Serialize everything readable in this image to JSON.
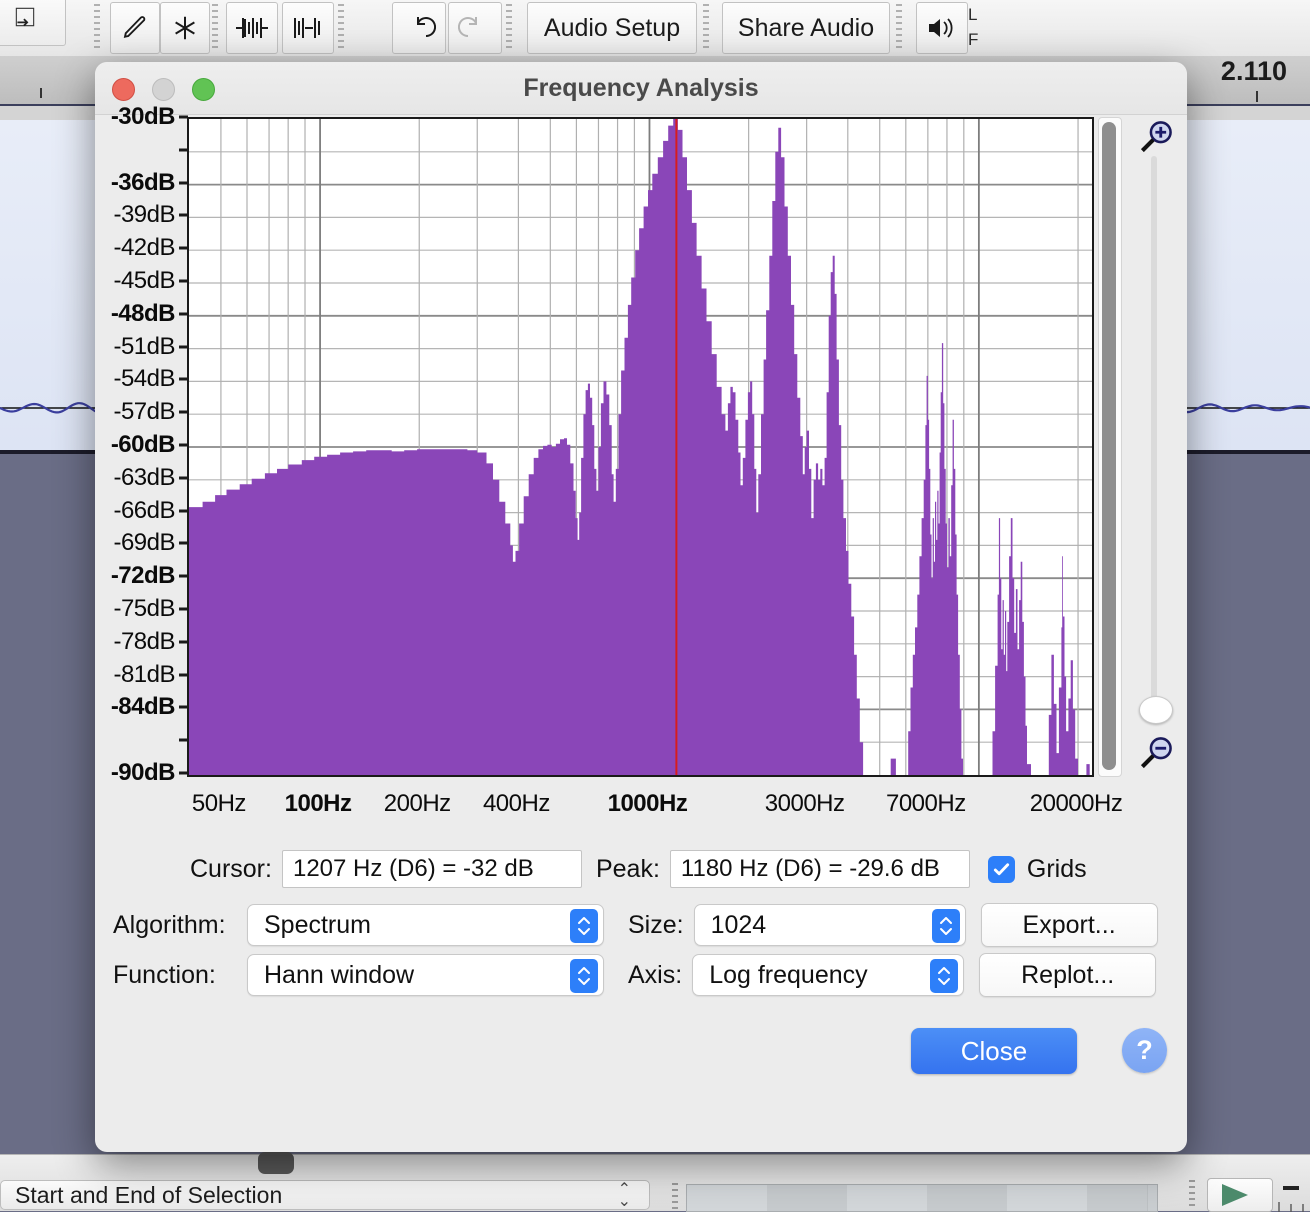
{
  "app": {
    "toolbar": {
      "buttons": [
        {
          "name": "draw-tool",
          "icon": "pencil-icon",
          "label": ""
        },
        {
          "name": "multi-tool",
          "icon": "asterisk-icon",
          "label": ""
        },
        {
          "name": "zoom-in-selection",
          "icon": "trim-audio-icon",
          "label": ""
        },
        {
          "name": "silence-selection",
          "icon": "silence-audio-icon",
          "label": ""
        },
        {
          "name": "undo",
          "icon": "undo-arrow-icon",
          "label": ""
        },
        {
          "name": "redo",
          "icon": "redo-arrow-icon",
          "label": ""
        }
      ],
      "audio_setup_label": "Audio Setup",
      "share_audio_label": "Share Audio",
      "speaker_icon": "speaker-icon",
      "channel_labels": [
        "L",
        "F"
      ]
    },
    "timeline": {
      "time_label": "2.110"
    },
    "statusbar": {
      "selection_label": "Start and End of Selection"
    }
  },
  "dialog": {
    "title": "Frequency Analysis",
    "window_controls": [
      "close",
      "minimize",
      "zoom"
    ],
    "cursor": {
      "label": "Cursor:",
      "value": "1207 Hz (D6) = -32 dB"
    },
    "peak": {
      "label": "Peak:",
      "value": "1180 Hz (D6) = -29.6 dB"
    },
    "grids": {
      "label": "Grids",
      "checked": true
    },
    "algorithm": {
      "label": "Algorithm:",
      "value": "Spectrum"
    },
    "function": {
      "label": "Function:",
      "value": "Hann window"
    },
    "size": {
      "label": "Size:",
      "value": "1024"
    },
    "axis": {
      "label": "Axis:",
      "value": "Log frequency"
    },
    "export_label": "Export...",
    "replot_label": "Replot...",
    "close_label": "Close",
    "help_label": "?",
    "zoom_in_icon": "magnifier-plus-icon",
    "zoom_out_icon": "magnifier-minus-icon",
    "colors": {
      "spectrum_fill": "#8a46b8",
      "cursor_line": "#d81c1c",
      "accent": "#2d7ff9",
      "grid": "#9a9a9a"
    }
  },
  "chart_data": {
    "type": "area",
    "title": "Frequency Analysis",
    "xlabel": "",
    "ylabel": "dB",
    "xscale": "log",
    "xlim": [
      40,
      22050
    ],
    "ylim": [
      -90,
      -30
    ],
    "grid": true,
    "ytick_labels": [
      "-30dB",
      "-36dB",
      "-39dB",
      "-42dB",
      "-45dB",
      "-48dB",
      "-51dB",
      "-54dB",
      "-57dB",
      "-60dB",
      "-63dB",
      "-66dB",
      "-69dB",
      "-72dB",
      "-75dB",
      "-78dB",
      "-81dB",
      "-84dB",
      "-90dB"
    ],
    "ytick_values": [
      -30,
      -36,
      -39,
      -42,
      -45,
      -48,
      -51,
      -54,
      -57,
      -60,
      -63,
      -66,
      -69,
      -72,
      -75,
      -78,
      -81,
      -84,
      -90
    ],
    "ytick_bold": [
      true,
      true,
      false,
      false,
      false,
      true,
      false,
      false,
      false,
      true,
      false,
      false,
      false,
      true,
      false,
      false,
      false,
      true,
      true
    ],
    "xtick_labels": [
      "50Hz",
      "100Hz",
      "200Hz",
      "400Hz",
      "1000Hz",
      "3000Hz",
      "7000Hz",
      "20000Hz"
    ],
    "xtick_values": [
      50,
      100,
      200,
      400,
      1000,
      3000,
      7000,
      20000
    ],
    "xtick_bold": [
      false,
      true,
      false,
      false,
      true,
      false,
      false,
      false
    ],
    "cursor_freq": 1207,
    "cursor_db": -32,
    "peak_freq": 1180,
    "peak_db": -29.6,
    "series_name": "Spectrum",
    "points": [
      [
        40,
        -65.5
      ],
      [
        44,
        -65.0
      ],
      [
        48,
        -64.4
      ],
      [
        52,
        -63.9
      ],
      [
        57,
        -63.4
      ],
      [
        62,
        -62.9
      ],
      [
        68,
        -62.4
      ],
      [
        74,
        -62.0
      ],
      [
        80,
        -61.6
      ],
      [
        88,
        -61.2
      ],
      [
        96,
        -60.9
      ],
      [
        105,
        -60.7
      ],
      [
        115,
        -60.5
      ],
      [
        126,
        -60.4
      ],
      [
        138,
        -60.3
      ],
      [
        150,
        -60.3
      ],
      [
        165,
        -60.4
      ],
      [
        180,
        -60.3
      ],
      [
        197,
        -60.2
      ],
      [
        215,
        -60.2
      ],
      [
        235,
        -60.2
      ],
      [
        257,
        -60.2
      ],
      [
        280,
        -60.3
      ],
      [
        300,
        -60.5
      ],
      [
        320,
        -61.5
      ],
      [
        335,
        -63.0
      ],
      [
        350,
        -65.0
      ],
      [
        365,
        -67.0
      ],
      [
        378,
        -69.0
      ],
      [
        385,
        -70.5
      ],
      [
        392,
        -69.5
      ],
      [
        402,
        -67.0
      ],
      [
        415,
        -64.5
      ],
      [
        430,
        -62.5
      ],
      [
        445,
        -61.0
      ],
      [
        460,
        -60.2
      ],
      [
        475,
        -59.9
      ],
      [
        490,
        -59.8
      ],
      [
        505,
        -60.0
      ],
      [
        520,
        -59.7
      ],
      [
        535,
        -59.3
      ],
      [
        550,
        -59.2
      ],
      [
        562,
        -59.8
      ],
      [
        575,
        -61.5
      ],
      [
        588,
        -64.0
      ],
      [
        597,
        -66.5
      ],
      [
        605,
        -68.5
      ],
      [
        612,
        -66.0
      ],
      [
        620,
        -61.0
      ],
      [
        630,
        -57.0
      ],
      [
        640,
        -54.8
      ],
      [
        650,
        -54.2
      ],
      [
        660,
        -55.5
      ],
      [
        670,
        -58.0
      ],
      [
        680,
        -62.0
      ],
      [
        690,
        -64.0
      ],
      [
        700,
        -60.0
      ],
      [
        712,
        -56.0
      ],
      [
        725,
        -54.0
      ],
      [
        740,
        -55.2
      ],
      [
        755,
        -58.0
      ],
      [
        768,
        -62.5
      ],
      [
        778,
        -65.0
      ],
      [
        790,
        -62.0
      ],
      [
        805,
        -57.0
      ],
      [
        820,
        -53.0
      ],
      [
        840,
        -50.0
      ],
      [
        860,
        -47.0
      ],
      [
        880,
        -44.5
      ],
      [
        905,
        -42.0
      ],
      [
        930,
        -40.0
      ],
      [
        960,
        -38.0
      ],
      [
        990,
        -36.5
      ],
      [
        1020,
        -35.0
      ],
      [
        1060,
        -33.5
      ],
      [
        1100,
        -32.0
      ],
      [
        1140,
        -30.6
      ],
      [
        1180,
        -29.6
      ],
      [
        1220,
        -31.0
      ],
      [
        1260,
        -33.5
      ],
      [
        1300,
        -36.5
      ],
      [
        1345,
        -39.5
      ],
      [
        1390,
        -42.5
      ],
      [
        1440,
        -45.5
      ],
      [
        1490,
        -48.5
      ],
      [
        1545,
        -51.5
      ],
      [
        1600,
        -54.5
      ],
      [
        1655,
        -57.0
      ],
      [
        1700,
        -58.5
      ],
      [
        1730,
        -56.0
      ],
      [
        1760,
        -54.5
      ],
      [
        1790,
        -55.0
      ],
      [
        1825,
        -57.5
      ],
      [
        1860,
        -60.5
      ],
      [
        1890,
        -63.5
      ],
      [
        1920,
        -61.0
      ],
      [
        1955,
        -57.5
      ],
      [
        1990,
        -55.0
      ],
      [
        2020,
        -54.0
      ],
      [
        2050,
        -57.0
      ],
      [
        2080,
        -62.0
      ],
      [
        2110,
        -66.0
      ],
      [
        2140,
        -62.5
      ],
      [
        2180,
        -57.0
      ],
      [
        2220,
        -52.0
      ],
      [
        2260,
        -47.5
      ],
      [
        2310,
        -42.5
      ],
      [
        2360,
        -37.5
      ],
      [
        2410,
        -33.0
      ],
      [
        2460,
        -30.8
      ],
      [
        2510,
        -33.5
      ],
      [
        2570,
        -38.0
      ],
      [
        2630,
        -42.5
      ],
      [
        2690,
        -47.0
      ],
      [
        2750,
        -51.5
      ],
      [
        2810,
        -55.5
      ],
      [
        2870,
        -59.0
      ],
      [
        2920,
        -62.5
      ],
      [
        2960,
        -60.0
      ],
      [
        3000,
        -58.5
      ],
      [
        3050,
        -62.0
      ],
      [
        3100,
        -66.5
      ],
      [
        3150,
        -63.0
      ],
      [
        3200,
        -61.5
      ],
      [
        3250,
        -63.0
      ],
      [
        3300,
        -62.0
      ],
      [
        3350,
        -63.5
      ],
      [
        3400,
        -61.0
      ],
      [
        3450,
        -55.0
      ],
      [
        3500,
        -48.0
      ],
      [
        3550,
        -44.0
      ],
      [
        3600,
        -42.5
      ],
      [
        3650,
        -46.0
      ],
      [
        3700,
        -52.0
      ],
      [
        3760,
        -58.0
      ],
      [
        3820,
        -63.0
      ],
      [
        3880,
        -66.5
      ],
      [
        3950,
        -69.5
      ],
      [
        4020,
        -72.5
      ],
      [
        4100,
        -75.5
      ],
      [
        4180,
        -79.0
      ],
      [
        4260,
        -83.0
      ],
      [
        4350,
        -87.0
      ],
      [
        4450,
        -90.0
      ],
      [
        4600,
        -90.0
      ],
      [
        4800,
        -90.0
      ],
      [
        5000,
        -90.0
      ],
      [
        5200,
        -90.0
      ],
      [
        5400,
        -88.5
      ],
      [
        5600,
        -90.0
      ],
      [
        5800,
        -90.0
      ],
      [
        6000,
        -90.0
      ],
      [
        6100,
        -86.0
      ],
      [
        6200,
        -82.0
      ],
      [
        6300,
        -79.0
      ],
      [
        6400,
        -76.5
      ],
      [
        6500,
        -73.5
      ],
      [
        6600,
        -70.0
      ],
      [
        6700,
        -66.5
      ],
      [
        6800,
        -63.0
      ],
      [
        6880,
        -58.0
      ],
      [
        6940,
        -53.5
      ],
      [
        7000,
        -57.5
      ],
      [
        7060,
        -62.0
      ],
      [
        7120,
        -68.0
      ],
      [
        7180,
        -72.0
      ],
      [
        7240,
        -66.5
      ],
      [
        7300,
        -70.5
      ],
      [
        7360,
        -65.0
      ],
      [
        7420,
        -68.5
      ],
      [
        7480,
        -64.0
      ],
      [
        7540,
        -67.0
      ],
      [
        7600,
        -60.5
      ],
      [
        7660,
        -55.0
      ],
      [
        7720,
        -50.5
      ],
      [
        7790,
        -56.0
      ],
      [
        7860,
        -62.0
      ],
      [
        7930,
        -67.0
      ],
      [
        8000,
        -71.0
      ],
      [
        8080,
        -66.5
      ],
      [
        8160,
        -70.0
      ],
      [
        8240,
        -63.5
      ],
      [
        8320,
        -57.5
      ],
      [
        8400,
        -62.0
      ],
      [
        8480,
        -68.0
      ],
      [
        8560,
        -73.5
      ],
      [
        8650,
        -79.0
      ],
      [
        8750,
        -84.0
      ],
      [
        8850,
        -88.5
      ],
      [
        8950,
        -90.0
      ],
      [
        9200,
        -90.0
      ],
      [
        9600,
        -90.0
      ],
      [
        10000,
        -90.0
      ],
      [
        10400,
        -90.0
      ],
      [
        10800,
        -90.0
      ],
      [
        11000,
        -86.0
      ],
      [
        11200,
        -80.0
      ],
      [
        11400,
        -73.5
      ],
      [
        11500,
        -66.5
      ],
      [
        11600,
        -72.0
      ],
      [
        11700,
        -78.5
      ],
      [
        11800,
        -74.0
      ],
      [
        11900,
        -79.0
      ],
      [
        12000,
        -75.0
      ],
      [
        12100,
        -80.5
      ],
      [
        12200,
        -76.0
      ],
      [
        12350,
        -70.0
      ],
      [
        12500,
        -66.5
      ],
      [
        12650,
        -72.0
      ],
      [
        12800,
        -77.0
      ],
      [
        12950,
        -73.0
      ],
      [
        13100,
        -78.5
      ],
      [
        13250,
        -74.0
      ],
      [
        13400,
        -70.5
      ],
      [
        13550,
        -76.0
      ],
      [
        13700,
        -81.0
      ],
      [
        13850,
        -85.5
      ],
      [
        14000,
        -89.0
      ],
      [
        14400,
        -90.0
      ],
      [
        15000,
        -90.0
      ],
      [
        15600,
        -90.0
      ],
      [
        16000,
        -90.0
      ],
      [
        16300,
        -84.5
      ],
      [
        16600,
        -79.0
      ],
      [
        16900,
        -83.5
      ],
      [
        17200,
        -88.0
      ],
      [
        17500,
        -82.0
      ],
      [
        17800,
        -76.5
      ],
      [
        17900,
        -70.0
      ],
      [
        18000,
        -75.5
      ],
      [
        18200,
        -81.0
      ],
      [
        18400,
        -86.0
      ],
      [
        18700,
        -83.0
      ],
      [
        19000,
        -79.5
      ],
      [
        19300,
        -84.0
      ],
      [
        19600,
        -88.5
      ],
      [
        20000,
        -90.0
      ],
      [
        20600,
        -90.0
      ],
      [
        21200,
        -89.0
      ],
      [
        21700,
        -90.0
      ],
      [
        22050,
        -90.0
      ]
    ]
  }
}
